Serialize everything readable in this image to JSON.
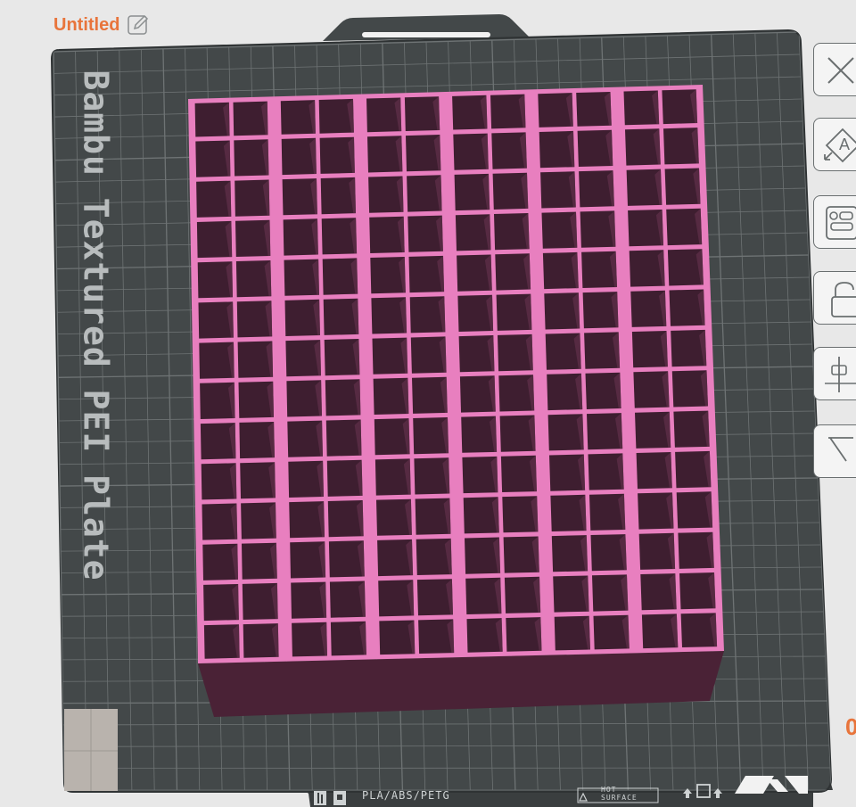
{
  "project": {
    "title": "Untitled"
  },
  "plate": {
    "label": "Bambu Textured PEI Plate",
    "filament_types": "PLA/ABS/PETG",
    "warning_line1": "HOT",
    "warning_line2": "SURFACE"
  },
  "edge_glyph": "0",
  "colors": {
    "accent": "#e8743b",
    "plate": "#434849",
    "grid": "#6e7374",
    "model_top": "#e87fbf",
    "model_cell": "#3e1e30",
    "model_side": "#4a2236"
  },
  "model": {
    "cell_columns": 12,
    "cell_rows": 14,
    "divider_groups": 6
  },
  "right_toolbar": {
    "icons": [
      "close-icon",
      "auto-orient-icon",
      "arrange-icon",
      "lock-icon",
      "split-icon",
      "cut-icon"
    ]
  }
}
